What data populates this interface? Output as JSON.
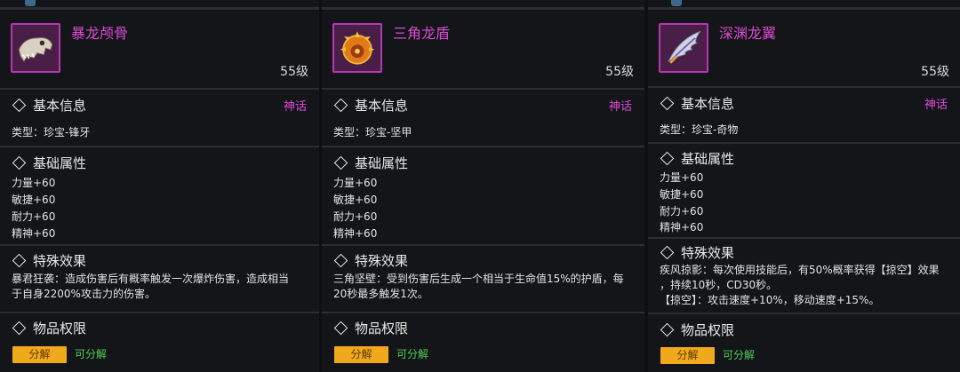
{
  "items": [
    {
      "name": "暴龙颅骨",
      "level": "55级",
      "icon": "dino-skull-icon",
      "basic_info_title": "基本信息",
      "rarity": "神话",
      "type": "类型：珍宝-锋牙",
      "attr_title": "基础属性",
      "attrs": [
        "力量+60",
        "敏捷+60",
        "耐力+60",
        "精神+60"
      ],
      "effect_title": "特殊效果",
      "effect": "暴君狂袭：造成伤害后有概率触发一次爆炸伤害，造成相当\n于自身2200%攻击力的伤害。",
      "perm_title": "物品权限",
      "decompose_button": "分解",
      "decompose_status": "可分解"
    },
    {
      "name": "三角龙盾",
      "level": "55级",
      "icon": "triceratops-shield-icon",
      "basic_info_title": "基本信息",
      "rarity": "神话",
      "type": "类型：珍宝-坚甲",
      "attr_title": "基础属性",
      "attrs": [
        "力量+60",
        "敏捷+60",
        "耐力+60",
        "精神+60"
      ],
      "effect_title": "特殊效果",
      "effect": "三角坚壁：受到伤害后生成一个相当于生命值15%的护盾，每\n20秒最多触发1次。",
      "perm_title": "物品权限",
      "decompose_button": "分解",
      "decompose_status": "可分解"
    },
    {
      "name": "深渊龙翼",
      "level": "55级",
      "icon": "dragon-wing-icon",
      "basic_info_title": "基本信息",
      "rarity": "神话",
      "type": "类型：珍宝-奇物",
      "attr_title": "基础属性",
      "attrs": [
        "力量+60",
        "敏捷+60",
        "耐力+60",
        "精神+60"
      ],
      "effect_title": "特殊效果",
      "effect": "疾风掠影：每次使用技能后，有50%概率获得【掠空】效果\n，持续10秒，CD30秒。\n【掠空】：攻击速度+10%，移动速度+15%。",
      "perm_title": "物品权限",
      "decompose_button": "分解",
      "decompose_status": "可分解"
    }
  ],
  "colors": {
    "name": "#d94bd3",
    "rarity": "#d94bd3",
    "button": "#f0a91c",
    "ok": "#4fcf56"
  }
}
